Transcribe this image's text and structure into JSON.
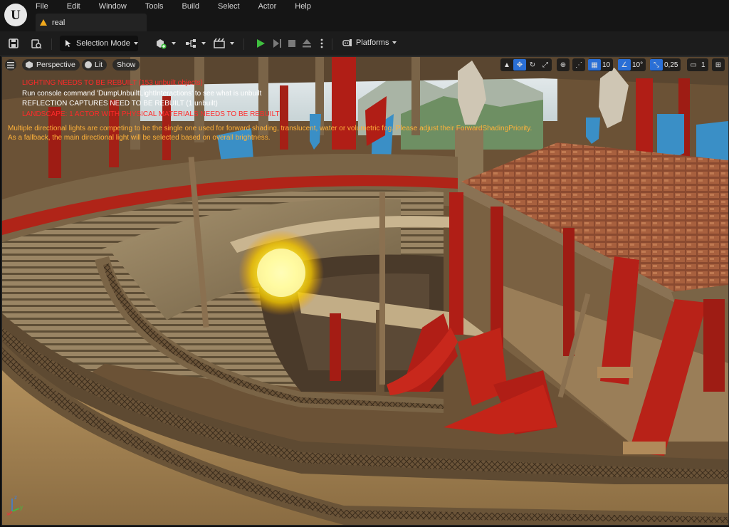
{
  "menu": {
    "items": [
      "File",
      "Edit",
      "Window",
      "Tools",
      "Build",
      "Select",
      "Actor",
      "Help"
    ]
  },
  "tab": {
    "label": "real"
  },
  "toolbar": {
    "selection_mode": "Selection Mode",
    "platforms": "Platforms"
  },
  "viewport": {
    "perspective": "Perspective",
    "lit": "Lit",
    "show": "Show",
    "grid_snap": "10",
    "rotation_snap": "10°",
    "scale_snap": "0,25",
    "camera_speed": "1"
  },
  "messages": {
    "lighting": "LIGHTING NEEDS TO BE REBUILT (153 unbuilt objects)",
    "console": "Run console command 'DumpUnbuiltLightInteractions' to see what is unbuilt",
    "reflection": "REFLECTION CAPTURES NEED TO BE REBUILT (1 unbuilt)",
    "landscape": "LANDSCAPE: 1 ACTOR WITH PHYSICAL MATERIALS NEEDS TO BE REBUILT",
    "directional_1": "Multiple directional lights are competing to be the single one used for forward shading, translucent, water or volumetric fog. Please adjust their ForwardShadingPriority.",
    "directional_2": "As a fallback, the main directional light will be selected based on overall brightness."
  },
  "colors": {
    "error_red": "#ff2a2a",
    "warning_orange": "#ffb23a",
    "accent_blue": "#2a6fd6",
    "play_green": "#3fbf3f"
  }
}
